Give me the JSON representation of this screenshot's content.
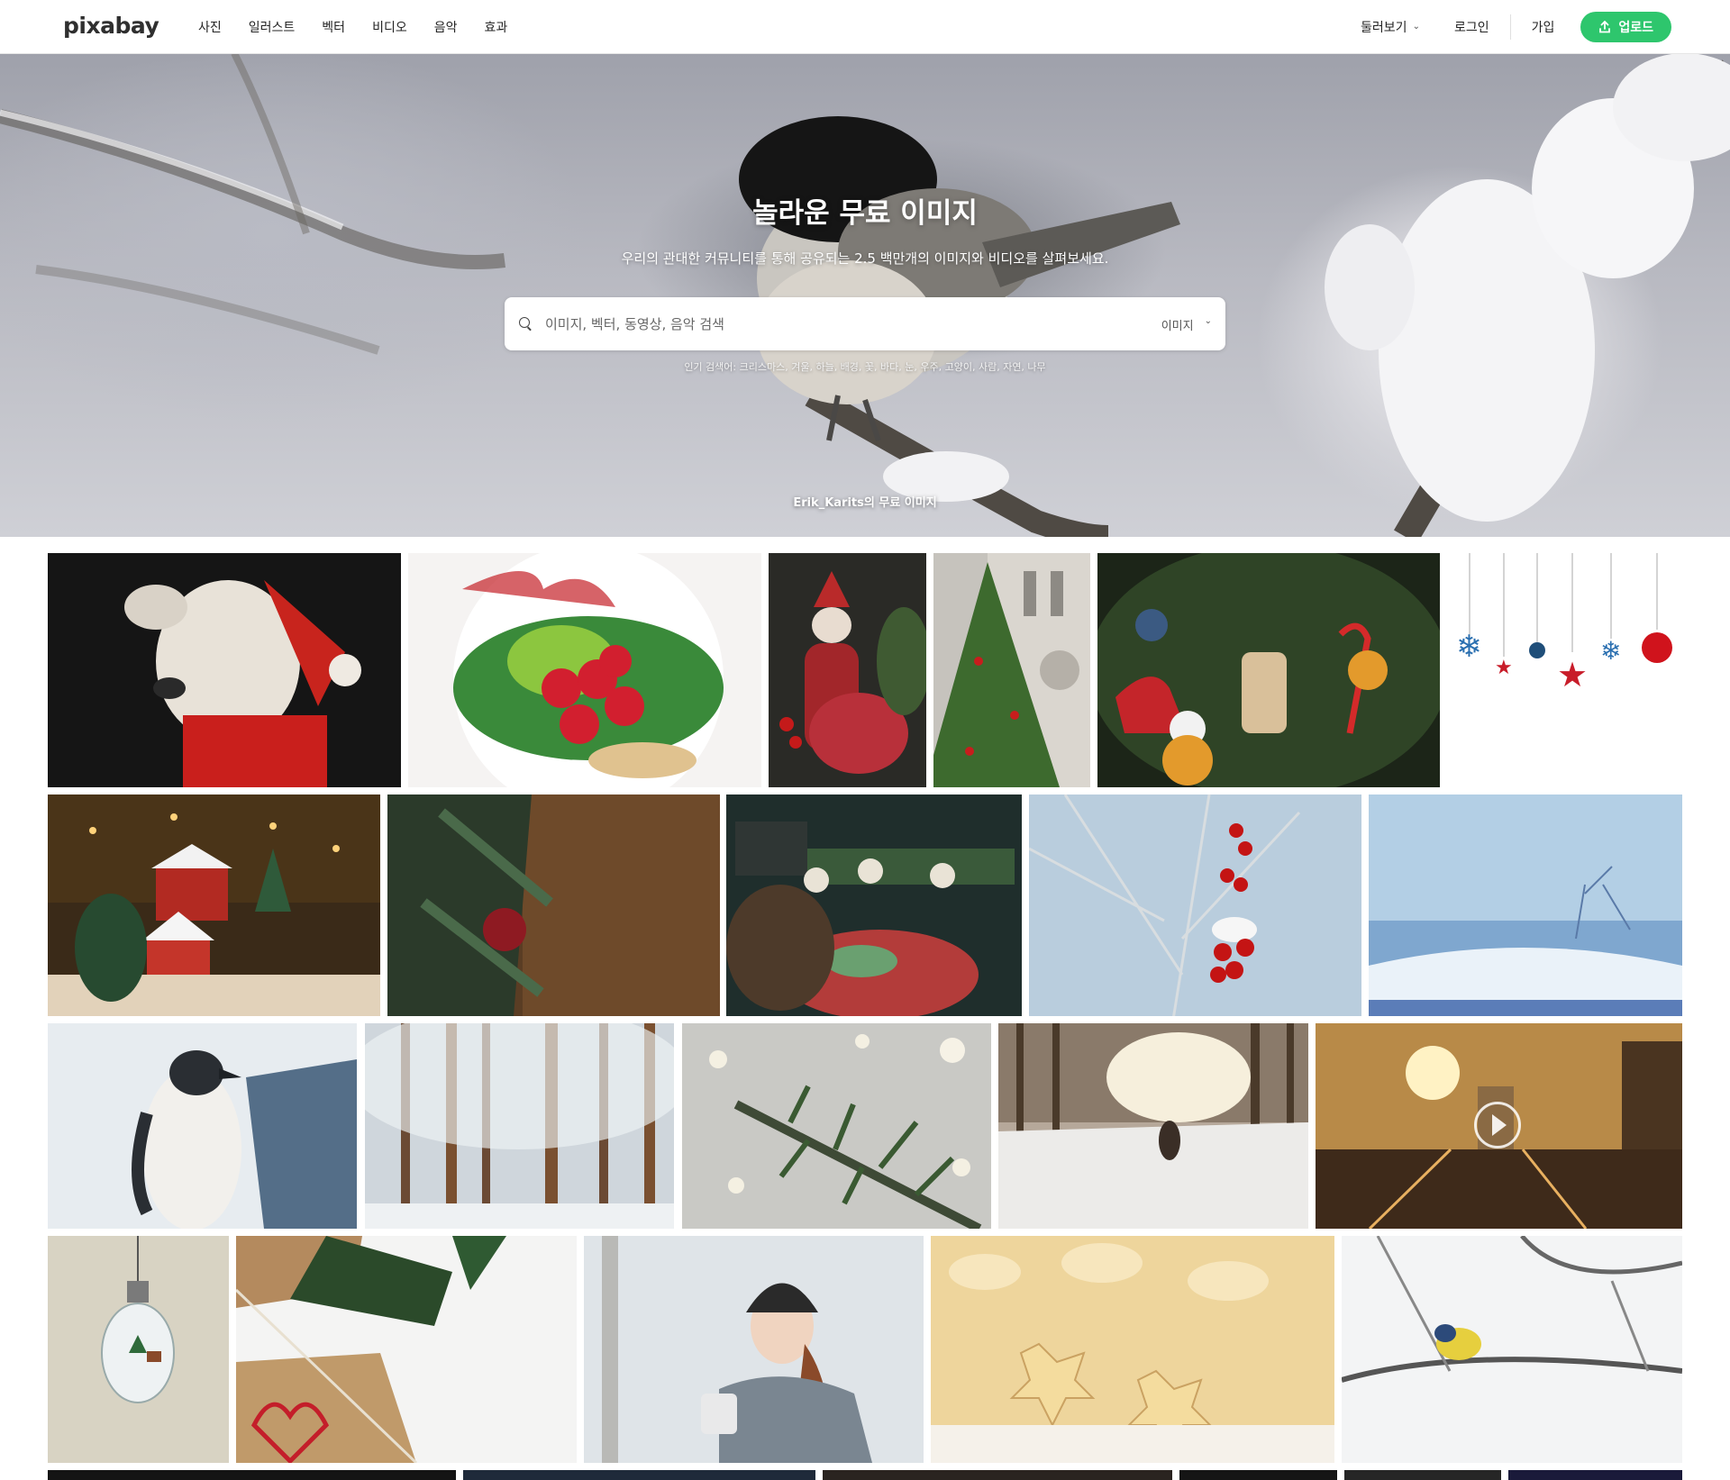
{
  "header": {
    "logo": "pixabay",
    "nav": [
      "사진",
      "일러스트",
      "벡터",
      "비디오",
      "음악",
      "효과"
    ],
    "explore_label": "둘러보기",
    "login_label": "로그인",
    "join_label": "가입",
    "upload_label": "업로드"
  },
  "hero": {
    "title": "놀라운 무료 이미지",
    "subtitle": "우리의 관대한 커뮤니티를 통해 공유되는 2.5 백만개의 이미지와 비디오를 살펴보세요.",
    "search_placeholder": "이미지, 벡터, 동영상, 음악 검색",
    "search_type": "이미지",
    "popular_label": "인기 검색어:",
    "popular_terms": "크리스마스, 겨울, 하늘, 배경, 꽃, 바다, 눈, 우주, 고양이, 사람, 자연, 나무",
    "credit": "Erik_Karits의 무료 이미지"
  },
  "gallery": {
    "images": [
      {
        "subject": "dog-santa"
      },
      {
        "subject": "holly-cookies"
      },
      {
        "subject": "santa-figurine"
      },
      {
        "subject": "cathedral-tree"
      },
      {
        "subject": "tree-ornaments"
      },
      {
        "subject": "hanging-ornaments"
      },
      {
        "subject": "christmas-village"
      },
      {
        "subject": "fir-bauble"
      },
      {
        "subject": "cookies-table"
      },
      {
        "subject": "rowan-berries"
      },
      {
        "subject": "winter-landscape"
      },
      {
        "subject": "penguin"
      },
      {
        "subject": "frosty-forest"
      },
      {
        "subject": "fir-branch-bokeh"
      },
      {
        "subject": "dog-snow-road"
      },
      {
        "subject": "sunset-traffic-video"
      },
      {
        "subject": "lightbulb-globe"
      },
      {
        "subject": "gift-wrap"
      },
      {
        "subject": "woman-winter"
      },
      {
        "subject": "star-cookies"
      },
      {
        "subject": "bird-frost"
      }
    ]
  }
}
